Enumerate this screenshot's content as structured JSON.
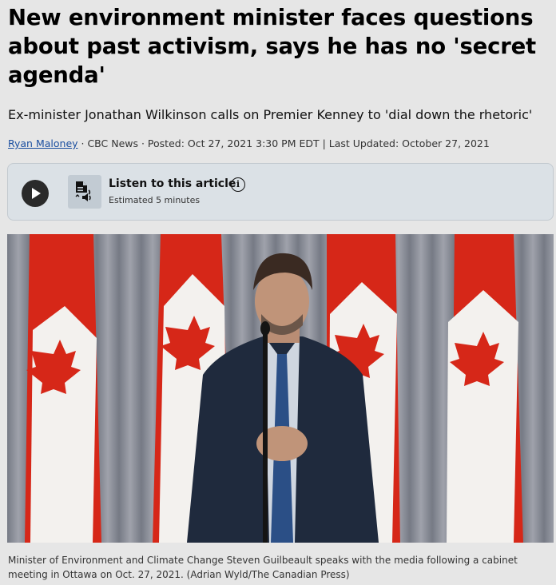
{
  "article": {
    "headline": "New environment minister faces questions about past activism, says he has no 'secret agenda'",
    "deck": "Ex-minister Jonathan Wilkinson calls on Premier Kenney to 'dial down the rhetoric'",
    "byline": {
      "author": "Ryan Maloney",
      "details": " · CBC News · Posted: Oct 27, 2021 3:30 PM EDT | Last Updated: October 27, 2021"
    }
  },
  "audio_player": {
    "title": "Listen to this article",
    "estimate": "Estimated 5 minutes",
    "info_glyph": "i",
    "icons": [
      "play-icon",
      "audio-document-icon",
      "info-icon"
    ]
  },
  "photo": {
    "caption": "Minister of Environment and Climate Change Steven Guilbeault speaks with the media following a cabinet meeting in Ottawa on Oct. 27, 2021. (Adrian Wyld/The Canadian Press)"
  },
  "colors": {
    "page_background": "#e6e6e6",
    "link": "#1b4fa0",
    "player_background": "#dbe1e6",
    "flag_red": "#d62718"
  }
}
